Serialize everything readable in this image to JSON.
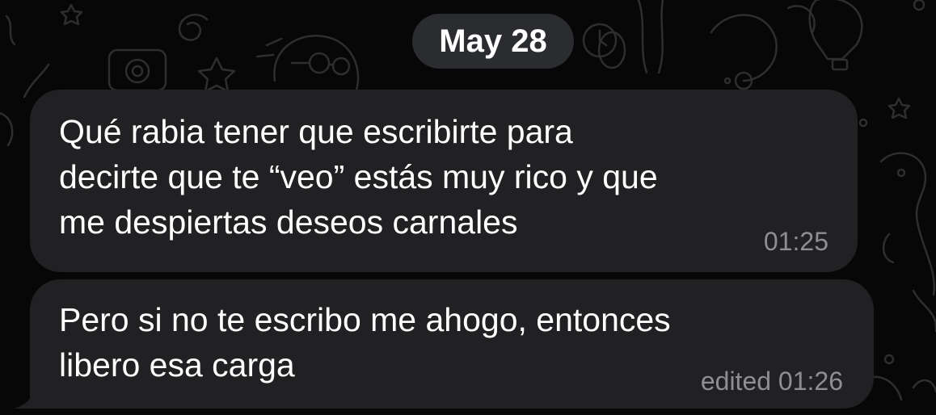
{
  "chat": {
    "date_separator": "May 28",
    "messages": [
      {
        "text": "Qué rabia tener que escribirte para\ndecirte que te “veo” estás muy rico y que\nme despiertas deseos carnales",
        "time": "01:25",
        "edited": false
      },
      {
        "text": "Pero si no te escribo me ahogo, entonces\nlibero esa carga",
        "time": "edited 01:26",
        "edited": true
      }
    ]
  },
  "colors": {
    "background": "#070707",
    "bubble": "#212124",
    "date_pill": "#2b2c30",
    "text": "#ffffff",
    "meta_text": "#8e8e93",
    "doodle_stroke": "#2e2e2e"
  }
}
